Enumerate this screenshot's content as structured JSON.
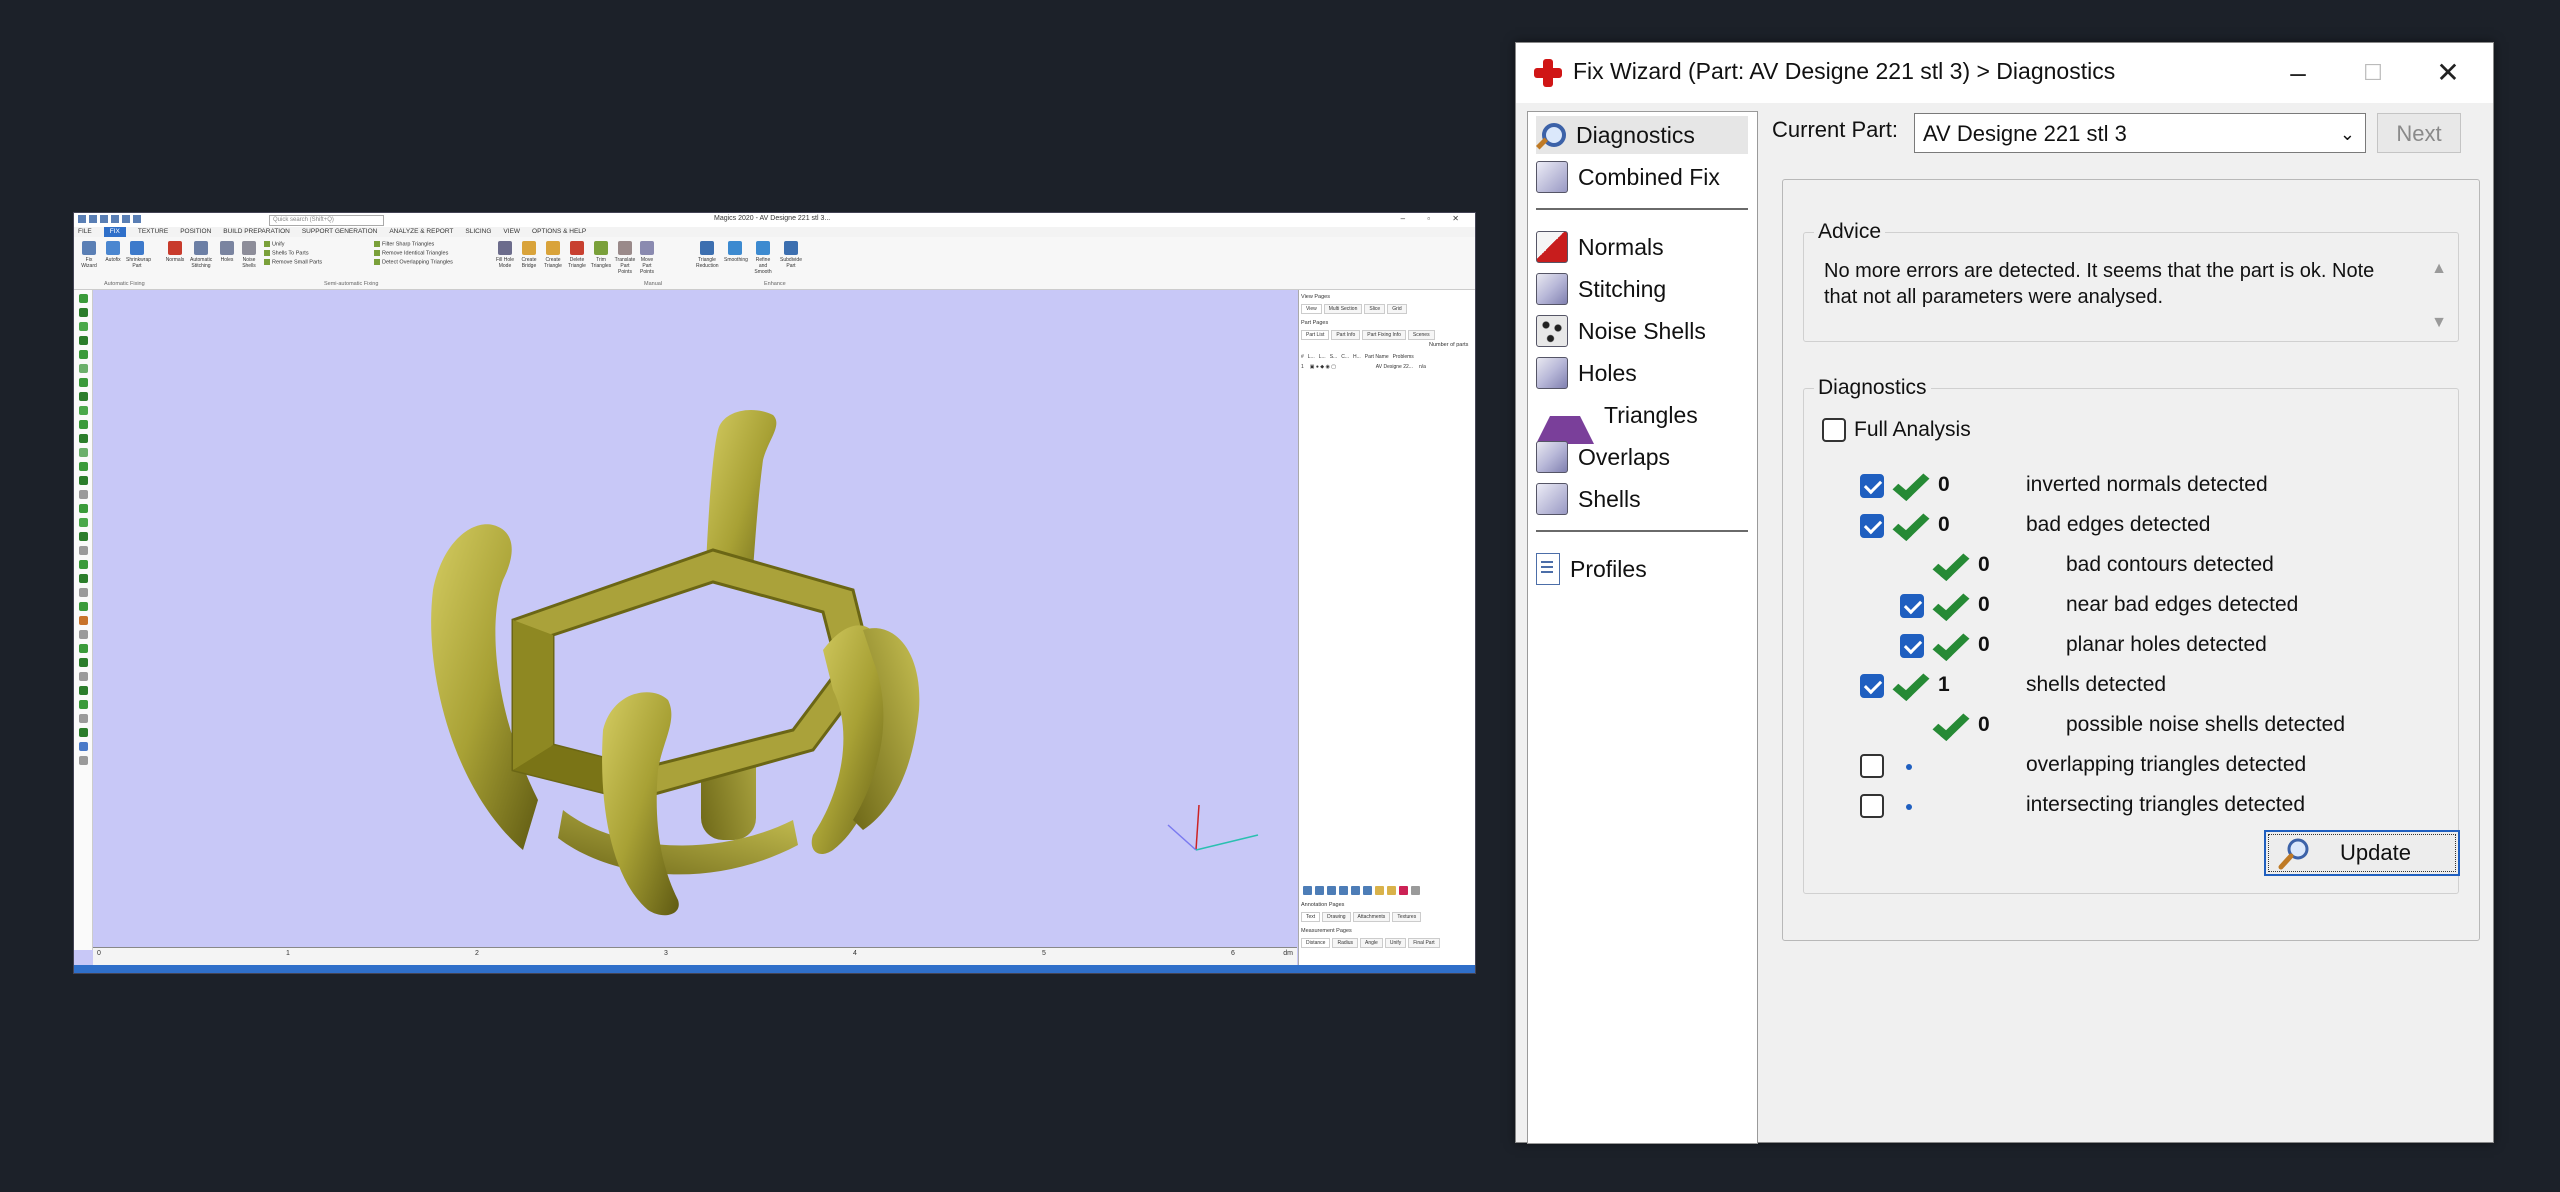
{
  "magics": {
    "search_placeholder": "Quick search (Shift+Q)",
    "title": "Magics 2020 - AV Designe 221 stl 3...",
    "menu": [
      "FILE",
      "FIX",
      "TEXTURE",
      "POSITION",
      "BUILD PREPARATION",
      "SUPPORT GENERATION",
      "ANALYZE & REPORT",
      "SLICING",
      "VIEW",
      "OPTIONS & HELP"
    ],
    "ribbon_buttons": [
      "Fix Wizard",
      "Autofix",
      "Shrinkwrap Part",
      "Normals",
      "Automatic Stitching",
      "Holes",
      "Noise Shells",
      "Unify",
      "Shells To Parts",
      "Remove Small Parts",
      "Filter Sharp Triangles",
      "Remove Identical Triangles",
      "Detect Overlapping Triangles",
      "Fill Hole Mode",
      "Create Bridge",
      "Create Triangle",
      "Delete Triangle",
      "Trim Triangles",
      "Translate Part Points",
      "Move Part Points",
      "Triangle Reduction",
      "Smoothing",
      "Refine and Smooth",
      "Subdivide Part"
    ],
    "ribbon_groups": [
      "Automatic Fixing",
      "Semi-automatic Fixing",
      "Manual",
      "Enhance"
    ],
    "ruler_ticks": [
      "0",
      "1",
      "2",
      "3",
      "4",
      "5",
      "6"
    ],
    "ruler_unit": "dm",
    "right_panel": {
      "view_pages": "View Pages",
      "view_tabs": [
        "View",
        "Multi Section",
        "Slice",
        "Grid"
      ],
      "part_pages": "Part Pages",
      "part_tabs": [
        "Part List",
        "Part Info",
        "Part Fixing Info",
        "Scenes"
      ],
      "number_of_parts": "Number of parts",
      "columns": [
        "#",
        "L...",
        "L...",
        "S...",
        "C...",
        "H...",
        "Part Name",
        "Problems"
      ],
      "row": {
        "index": "1",
        "name": "AV Designe 22...",
        "problems": "n/a"
      },
      "annotation_pages": "Annotation Pages",
      "annotation_tabs": [
        "Text",
        "Drawing",
        "Attachments",
        "Textures"
      ],
      "measurement_pages": "Measurement Pages",
      "measurement_tabs": [
        "Distance",
        "Radius",
        "Angle",
        "Unify",
        "Final Part"
      ]
    },
    "colors": {
      "viewport": "#c8c8f7",
      "model": "#a5a032",
      "ribbon_blue": "#2f6fc9"
    }
  },
  "wizard": {
    "title": "Fix Wizard (Part: AV Designe 221 stl 3) > Diagnostics",
    "nav": {
      "group1": [
        {
          "label": "Diagnostics",
          "icon": "magnifier-icon",
          "selected": true
        },
        {
          "label": "Combined Fix",
          "icon": "stack-icon"
        }
      ],
      "group2": [
        {
          "label": "Normals",
          "icon": "normals-cube-icon"
        },
        {
          "label": "Stitching",
          "icon": "stitching-cube-icon"
        },
        {
          "label": "Noise Shells",
          "icon": "noise-shells-icon"
        },
        {
          "label": "Holes",
          "icon": "holes-cube-icon"
        },
        {
          "label": "Triangles",
          "icon": "triangles-icon"
        },
        {
          "label": "Overlaps",
          "icon": "overlaps-cube-icon"
        },
        {
          "label": "Shells",
          "icon": "shells-cube-icon"
        }
      ],
      "group3": [
        {
          "label": "Profiles",
          "icon": "document-icon"
        }
      ]
    },
    "current_part_label": "Current Part:",
    "current_part_value": "AV Designe 221 stl 3",
    "next_label": "Next",
    "advice": {
      "legend": "Advice",
      "text": "No more errors are detected. It seems that the part is ok. Note that not all parameters were analysed."
    },
    "diagnostics": {
      "legend": "Diagnostics",
      "full_analysis_label": "Full Analysis",
      "full_analysis_checked": false,
      "rows": [
        {
          "checkbox": true,
          "checked": true,
          "status": "ok",
          "count": "0",
          "text": "inverted normals detected",
          "indent": 0
        },
        {
          "checkbox": true,
          "checked": true,
          "status": "ok",
          "count": "0",
          "text": "bad edges detected",
          "indent": 0
        },
        {
          "checkbox": false,
          "checked": false,
          "status": "ok",
          "count": "0",
          "text": "bad contours detected",
          "indent": 1
        },
        {
          "checkbox": true,
          "checked": true,
          "status": "ok",
          "count": "0",
          "text": "near bad edges detected",
          "indent": 1
        },
        {
          "checkbox": true,
          "checked": true,
          "status": "ok",
          "count": "0",
          "text": "planar holes detected",
          "indent": 1
        },
        {
          "checkbox": true,
          "checked": true,
          "status": "ok",
          "count": "1",
          "text": "shells detected",
          "indent": 0
        },
        {
          "checkbox": false,
          "checked": false,
          "status": "ok",
          "count": "0",
          "text": "possible noise shells detected",
          "indent": 1
        },
        {
          "checkbox": true,
          "checked": false,
          "status": "pending",
          "count": "",
          "text": "overlapping triangles detected",
          "indent": 0
        },
        {
          "checkbox": true,
          "checked": false,
          "status": "pending",
          "count": "",
          "text": "intersecting triangles detected",
          "indent": 0
        }
      ],
      "update_label": "Update"
    }
  }
}
